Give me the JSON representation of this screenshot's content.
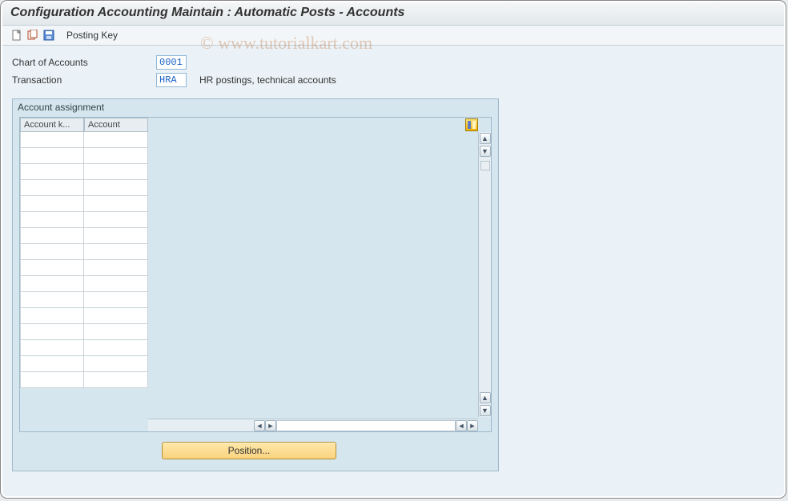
{
  "title": "Configuration Accounting Maintain : Automatic Posts - Accounts",
  "toolbar": {
    "posting_key_label": "Posting Key"
  },
  "fields": {
    "chart_of_accounts": {
      "label": "Chart of Accounts",
      "value": "0001"
    },
    "transaction": {
      "label": "Transaction",
      "value": "HRA",
      "desc": "HR postings, technical accounts"
    }
  },
  "panel": {
    "title": "Account assignment",
    "columns": {
      "col1": "Account k...",
      "col2": "Account"
    },
    "row_count": 16,
    "position_button": "Position..."
  },
  "watermark": "© www.tutorialkart.com"
}
